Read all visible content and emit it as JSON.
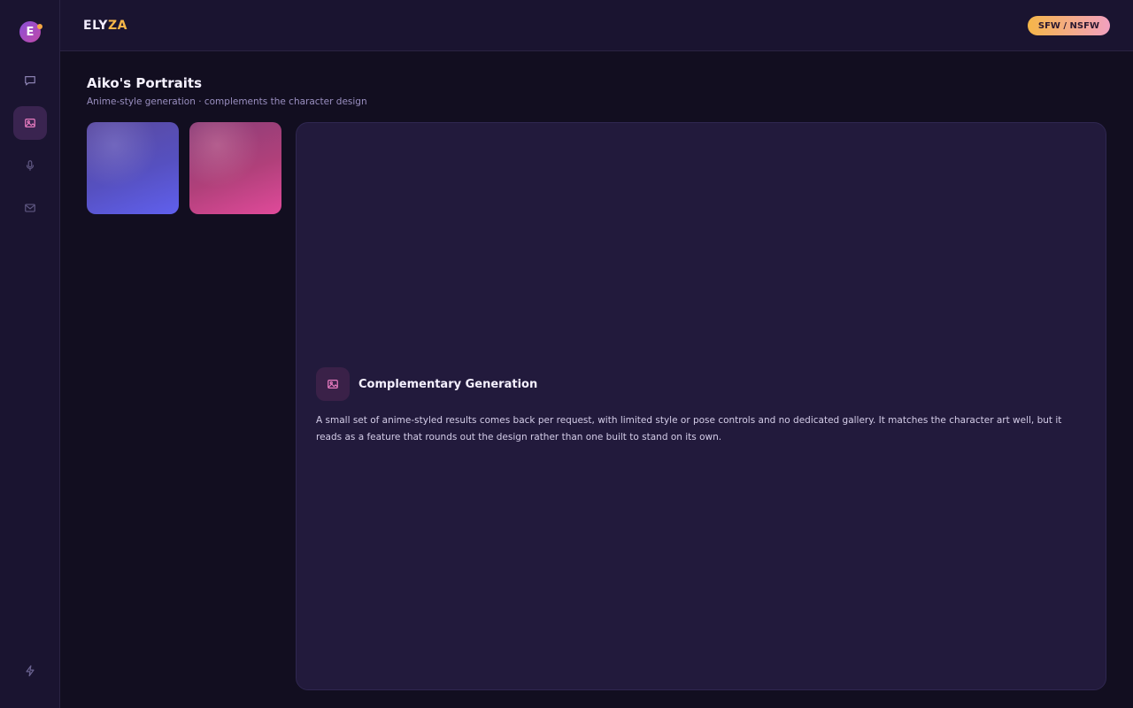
{
  "sidebar": {
    "logo_letter": "E",
    "items": [
      {
        "icon": "chat-icon",
        "active": false
      },
      {
        "icon": "image-icon",
        "active": true
      },
      {
        "icon": "microphone-icon",
        "active": false
      },
      {
        "icon": "mail-icon",
        "active": false
      }
    ],
    "bottom_icon": "bolt-icon"
  },
  "header": {
    "brand_part1": "ELY",
    "brand_part2": "ZA",
    "mode_label": "SFW / NSFW"
  },
  "page": {
    "title": "Aiko's Portraits",
    "subtitle": "Anime-style generation · complements the character design"
  },
  "feature": {
    "icon": "image-icon",
    "title": "Complementary Generation",
    "description": "A small set of anime-styled results comes back per request, with limited style or pose controls and no dedicated gallery. It matches the character art well, but it reads as a feature that rounds out the design rather than one built to stand on its own."
  },
  "colors": {
    "accent": "#f5b648",
    "active_nav": "#3a2450",
    "panel": "#221a3c",
    "background": "#120e20"
  }
}
